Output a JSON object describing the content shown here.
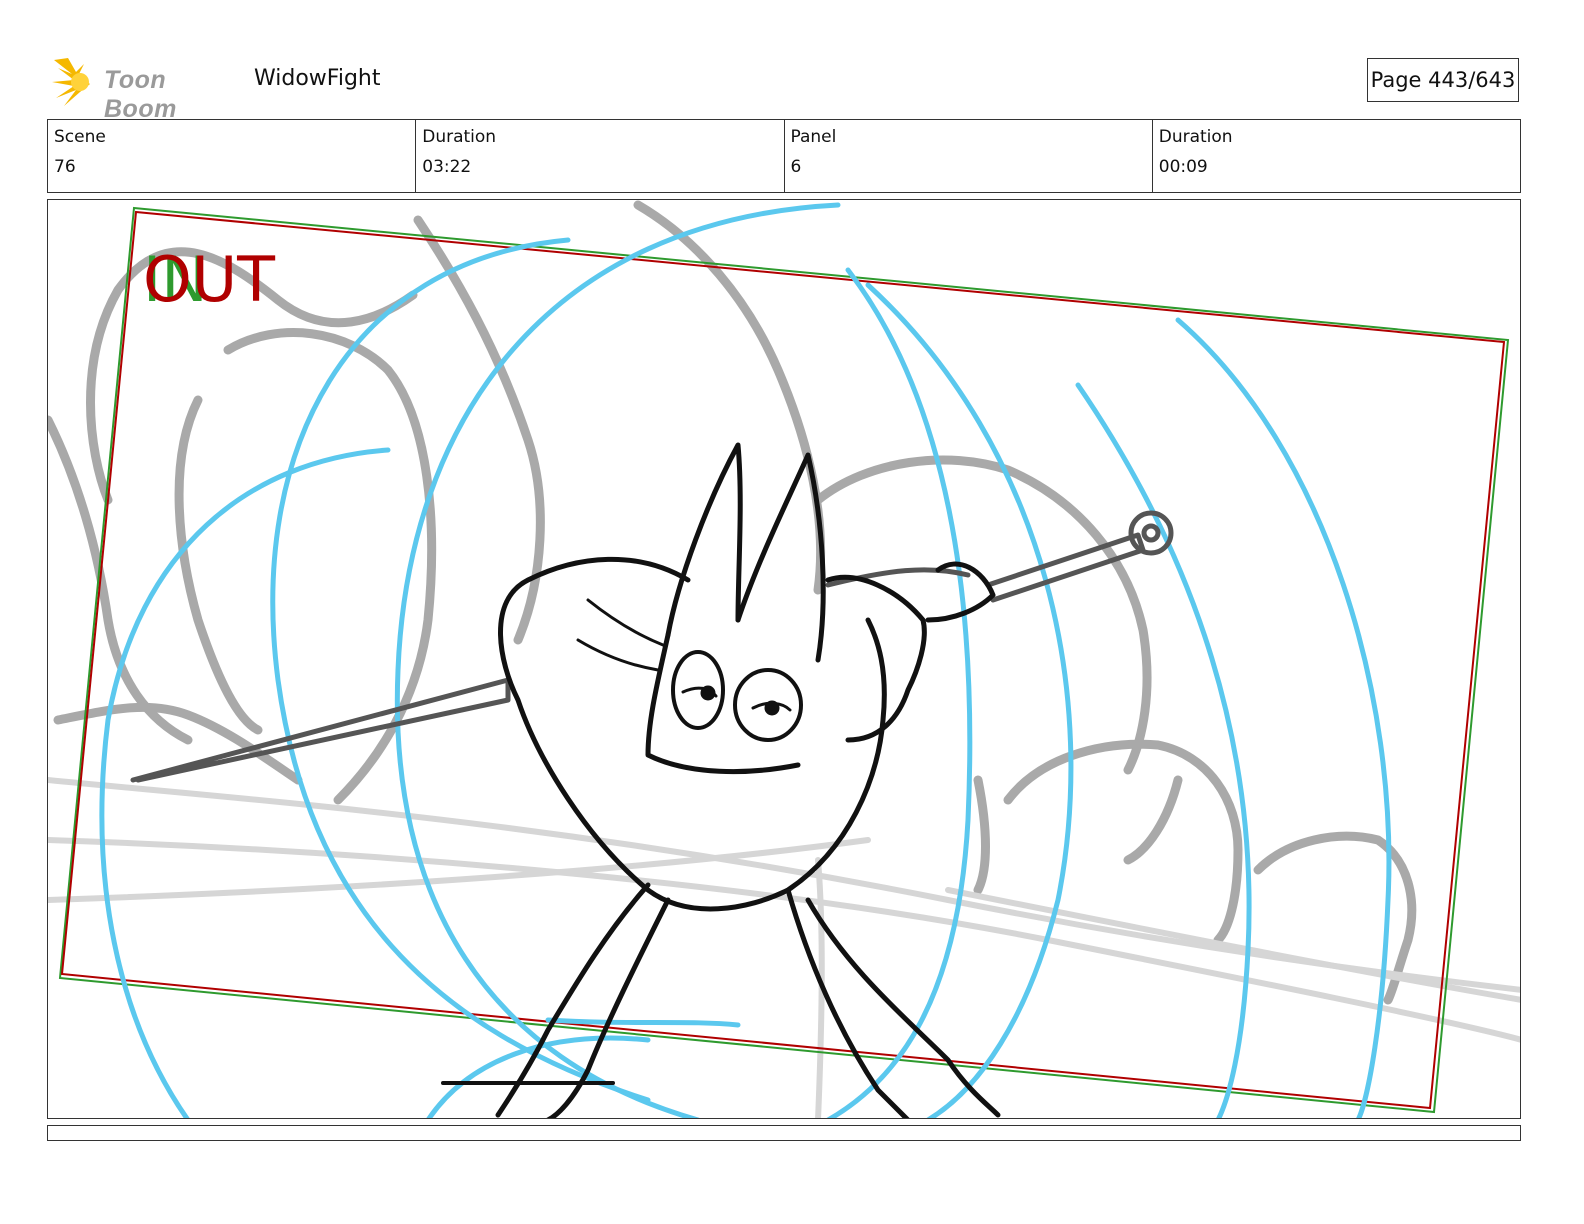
{
  "header": {
    "logo_text": "Toon Boom",
    "project_title": "WidowFight",
    "page_indicator": "Page 443/643"
  },
  "info": {
    "scene_label": "Scene",
    "scene_value": "76",
    "scene_duration_label": "Duration",
    "scene_duration_value": "03:22",
    "panel_label": "Panel",
    "panel_value": "6",
    "panel_duration_label": "Duration",
    "panel_duration_value": "00:09"
  },
  "panel": {
    "in_marker": "IN",
    "out_marker": "OUT"
  },
  "caption": {
    "text": ""
  },
  "colors": {
    "camera_frame_red": "#b00000",
    "camera_frame_green": "#2e9a2e",
    "motion_lines": "#5bc8ee",
    "background_sketch": "#a9a9a9",
    "character_line": "#111111",
    "logo_star": "#f5b800"
  }
}
